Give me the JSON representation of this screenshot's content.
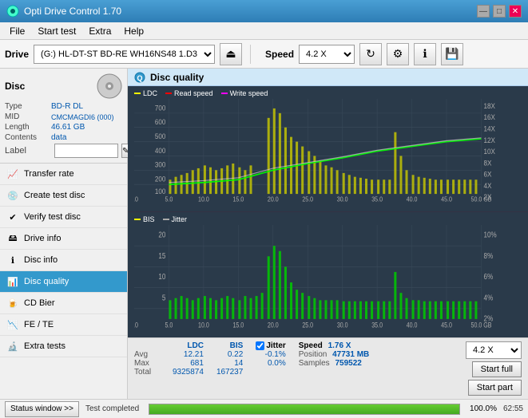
{
  "titlebar": {
    "title": "Opti Drive Control 1.70",
    "min_label": "—",
    "max_label": "□",
    "close_label": "✕"
  },
  "menubar": {
    "items": [
      "File",
      "Start test",
      "Extra",
      "Help"
    ]
  },
  "toolbar": {
    "drive_label": "Drive",
    "drive_value": "(G:)  HL-DT-ST BD-RE  WH16NS48 1.D3",
    "speed_label": "Speed",
    "speed_value": "4.2 X"
  },
  "sidebar": {
    "disc_title": "Disc",
    "disc_fields": [
      {
        "key": "Type",
        "value": "BD-R DL"
      },
      {
        "key": "MID",
        "value": "CMCMAGDI6 (000)"
      },
      {
        "key": "Length",
        "value": "46.61 GB"
      },
      {
        "key": "Contents",
        "value": "data"
      },
      {
        "key": "Label",
        "value": ""
      }
    ],
    "menu_items": [
      {
        "id": "transfer-rate",
        "label": "Transfer rate",
        "icon": "📈"
      },
      {
        "id": "create-test-disc",
        "label": "Create test disc",
        "icon": "💿"
      },
      {
        "id": "verify-test-disc",
        "label": "Verify test disc",
        "icon": "✔"
      },
      {
        "id": "drive-info",
        "label": "Drive info",
        "icon": "ℹ"
      },
      {
        "id": "disc-info",
        "label": "Disc info",
        "icon": "ℹ"
      },
      {
        "id": "disc-quality",
        "label": "Disc quality",
        "icon": "📊",
        "active": true
      },
      {
        "id": "cd-bier",
        "label": "CD Bier",
        "icon": "🍺"
      },
      {
        "id": "fe-te",
        "label": "FE / TE",
        "icon": "📉"
      },
      {
        "id": "extra-tests",
        "label": "Extra tests",
        "icon": "🔬"
      }
    ]
  },
  "quality_panel": {
    "title": "Disc quality",
    "chart1": {
      "legend": [
        "LDC",
        "Read speed",
        "Write speed"
      ],
      "y_max": 700,
      "y_right_labels": [
        "18X",
        "16X",
        "14X",
        "12X",
        "10X",
        "8X",
        "6X",
        "4X",
        "2X"
      ],
      "x_labels": [
        "0.0",
        "5.0",
        "10.0",
        "15.0",
        "20.0",
        "25.0",
        "30.0",
        "35.0",
        "40.0",
        "45.0",
        "50.0 GB"
      ]
    },
    "chart2": {
      "legend": [
        "BIS",
        "Jitter"
      ],
      "y_max": 20,
      "y_right_labels": [
        "10%",
        "8%",
        "6%",
        "4%",
        "2%"
      ],
      "x_labels": [
        "0.0",
        "5.0",
        "10.0",
        "15.0",
        "20.0",
        "25.0",
        "30.0",
        "35.0",
        "40.0",
        "45.0",
        "50.0 GB"
      ]
    }
  },
  "stats": {
    "columns": [
      "LDC",
      "BIS"
    ],
    "jitter_label": "Jitter",
    "jitter_checked": true,
    "rows": [
      {
        "label": "Avg",
        "ldc": "12.21",
        "bis": "0.22",
        "jitter": "-0.1%"
      },
      {
        "label": "Max",
        "ldc": "681",
        "bis": "14",
        "jitter": "0.0%"
      },
      {
        "label": "Total",
        "ldc": "9325874",
        "bis": "167237",
        "jitter": ""
      }
    ],
    "speed_label": "Speed",
    "speed_value": "1.76 X",
    "speed_select": "4.2 X",
    "position_label": "Position",
    "position_value": "47731 MB",
    "samples_label": "Samples",
    "samples_value": "759522",
    "btn_start_full": "Start full",
    "btn_start_part": "Start part"
  },
  "statusbar": {
    "status_btn_label": "Status window >>",
    "status_text": "Test completed",
    "progress_percent": 100,
    "time_value": "62:55"
  }
}
